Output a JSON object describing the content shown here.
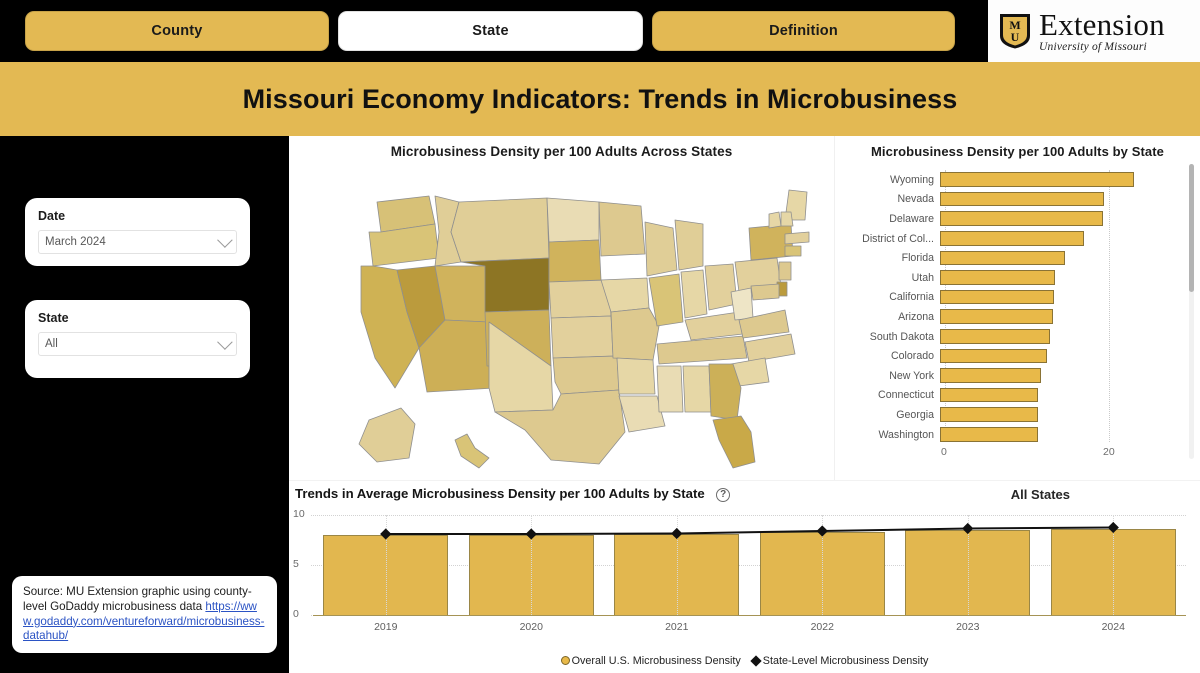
{
  "header": {
    "tabs": [
      {
        "label": "County",
        "active": false
      },
      {
        "label": "State",
        "active": true
      },
      {
        "label": "Definition",
        "active": false
      }
    ],
    "logo": {
      "main": "Extension",
      "sub": "University of Missouri",
      "mark": "MU"
    },
    "title": "Missouri Economy Indicators: Trends in Microbusiness"
  },
  "sidebar": {
    "date_filter": {
      "label": "Date",
      "value": "March 2024",
      "icon": "chevron-down-icon"
    },
    "state_filter": {
      "label": "State",
      "value": "All",
      "icon": "chevron-down-icon"
    },
    "source": {
      "text": "Source: MU Extension graphic using county-level GoDaddy microbusiness data",
      "link": "https://www.godaddy.com/ventureforward/microbusiness-datahub/"
    }
  },
  "map_panel": {
    "title": "Microbusiness Density per 100 Adults Across States"
  },
  "colors": {
    "gold": "#E3B953",
    "bar_gold": "#E8B949",
    "bar_stroke": "#8A7335",
    "black": "#000000",
    "link": "#2B53C4"
  },
  "chart_data": [
    {
      "type": "bar",
      "orientation": "horizontal",
      "title": "Microbusiness Density per 100 Adults by State",
      "xlabel": "",
      "ylabel": "",
      "xlim": [
        0,
        24
      ],
      "xticks": [
        0,
        20
      ],
      "xticklabels": [
        "0",
        "20"
      ],
      "grid": true,
      "categories": [
        "Wyoming",
        "Nevada",
        "Delaware",
        "District of Col...",
        "Florida",
        "Utah",
        "California",
        "Arizona",
        "South Dakota",
        "Colorado",
        "New York",
        "Connecticut",
        "Georgia",
        "Washington"
      ],
      "values": [
        23.7,
        20.0,
        19.9,
        17.5,
        15.2,
        14.0,
        13.9,
        13.8,
        13.4,
        13.0,
        12.3,
        12.0,
        11.9,
        11.9
      ],
      "scrollable": true
    },
    {
      "type": "bar",
      "title": "Trends in Average Microbusiness Density per 100 Adults by State",
      "subtitle": "All States",
      "help_icon": "question-mark-icon",
      "categories": [
        "2019",
        "2020",
        "2021",
        "2022",
        "2023",
        "2024"
      ],
      "xlabel": "",
      "ylabel": "",
      "ylim": [
        0,
        10
      ],
      "yticks": [
        0,
        5,
        10
      ],
      "yticklabels": [
        "0",
        "5",
        "10"
      ],
      "grid": true,
      "series": [
        {
          "name": "Overall U.S. Microbusiness Density",
          "marker": "circle",
          "type": "bar",
          "values": [
            8.05,
            8.05,
            8.1,
            8.3,
            8.55,
            8.6
          ]
        },
        {
          "name": "State-Level Microbusiness Density",
          "marker": "diamond",
          "type": "line",
          "values": [
            8.1,
            8.1,
            8.15,
            8.4,
            8.65,
            8.75
          ]
        }
      ],
      "legend_position": "bottom"
    }
  ]
}
